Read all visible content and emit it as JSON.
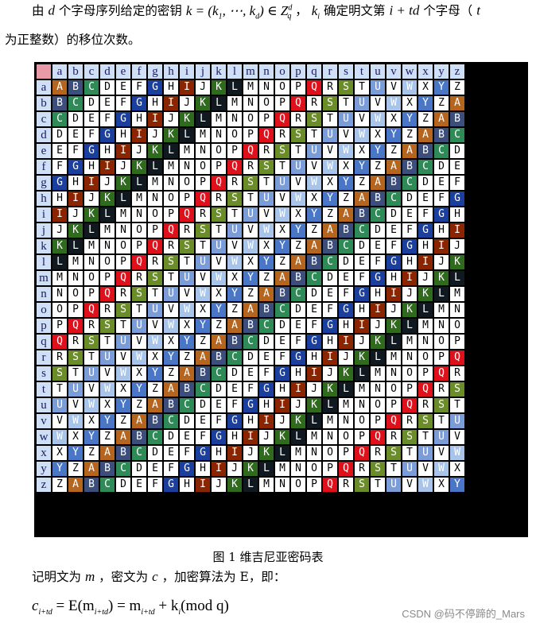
{
  "intro": {
    "t1": "由",
    "d_var": "d",
    "t2": "个字母序列给定的密钥",
    "key_expr": "k = (k",
    "key_sub1": "1",
    "key_mid": ", ⋯, k",
    "key_subd": "d",
    "key_end": ") ∈ Z",
    "key_subq": "q",
    "key_supd": "d",
    "t3": "，",
    "ki": "k",
    "ki_sub": "i",
    "t4": "确定明文第",
    "index_expr": "i + td",
    "t5": "个字母（",
    "t_var": "t",
    "line2": "为正整数）的移位次数。"
  },
  "table": {
    "headers": [
      "a",
      "b",
      "c",
      "d",
      "e",
      "f",
      "g",
      "h",
      "i",
      "j",
      "k",
      "l",
      "m",
      "n",
      "o",
      "p",
      "q",
      "r",
      "s",
      "t",
      "u",
      "v",
      "w",
      "x",
      "y",
      "z"
    ],
    "alphabet": "ABCDEFGHIJKLMNOPQRSTUVWXYZ",
    "colors": {
      "A": "#b5651d",
      "B": "#3c4f7c",
      "C": "#2e8b57",
      "D": "#ffffff",
      "E": "#ffffff",
      "F": "#ffffff",
      "G": "#1a3f9e",
      "H": "#ffffff",
      "I": "#8b2500",
      "J": "#ffffff",
      "K": "#2e6b1c",
      "L": "#101820",
      "M": "#ffffff",
      "N": "#ffffff",
      "O": "#ffffff",
      "P": "#ffffff",
      "Q": "#e0101a",
      "R": "#ffffff",
      "S": "#6a8d2a",
      "T": "#ffffff",
      "U": "#7a9cd8",
      "V": "#ffffff",
      "W": "#a8c4ea",
      "X": "#ffffff",
      "Y": "#4a76c8",
      "Z": "#ffffff"
    },
    "text_colors": {
      "A": "#ffffff",
      "B": "#ffffff",
      "C": "#ffffff",
      "G": "#ffffff",
      "I": "#ffffff",
      "K": "#ffffff",
      "L": "#ffffff",
      "Q": "#ffffff",
      "S": "#ffffff",
      "U": "#ffffff",
      "W": "#ffffff",
      "Y": "#ffffff"
    },
    "header_color": "#cfe0f6",
    "corner_color": "#e89aa6"
  },
  "caption": "图 1 维吉尼亚密码表",
  "para3": {
    "t1": "记明文为",
    "m": "m",
    "t2": "，密文为",
    "c": "c",
    "t3": "，加密算法为 E，即："
  },
  "formula": {
    "c": "c",
    "c_sub": "i+td",
    "eq1": " = E(m",
    "m_sub": "i+td",
    "eq2": ") = m",
    "m2_sub": "i+td",
    "plus": " + k",
    "k_sub": "i",
    "mod": "(mod q)"
  },
  "watermark": "CSDN @码不停蹄的_Mars"
}
